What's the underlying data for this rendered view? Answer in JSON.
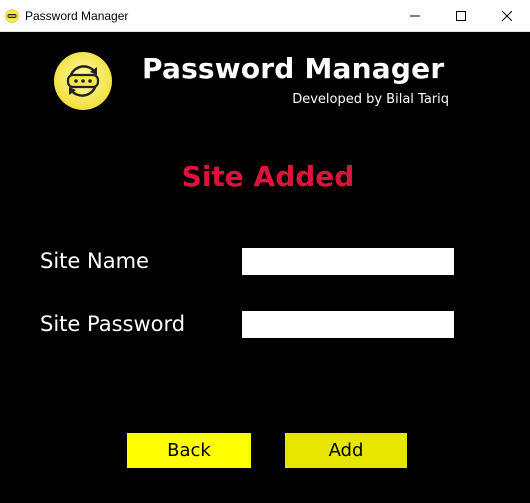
{
  "window": {
    "title": "Password Manager",
    "icon": "password-manager-app-icon",
    "controls": {
      "minimize_icon": "minimize-icon",
      "maximize_icon": "maximize-icon",
      "close_icon": "close-icon"
    }
  },
  "header": {
    "logo_icon": "password-logo-icon",
    "title": "Password Manager",
    "subtitle": "Developed by Bilal Tariq"
  },
  "status": {
    "message": "Site Added",
    "color": "#dc143c"
  },
  "form": {
    "site_name": {
      "label": "Site Name",
      "value": "",
      "placeholder": ""
    },
    "site_password": {
      "label": "Site Password",
      "value": "",
      "placeholder": ""
    }
  },
  "buttons": {
    "back_label": "Back",
    "add_label": "Add"
  },
  "colors": {
    "background": "#000000",
    "accent_yellow": "#ffff00",
    "add_button": "#e6e600",
    "logo_yellow": "#f7e84a",
    "status_red": "#dc143c"
  }
}
